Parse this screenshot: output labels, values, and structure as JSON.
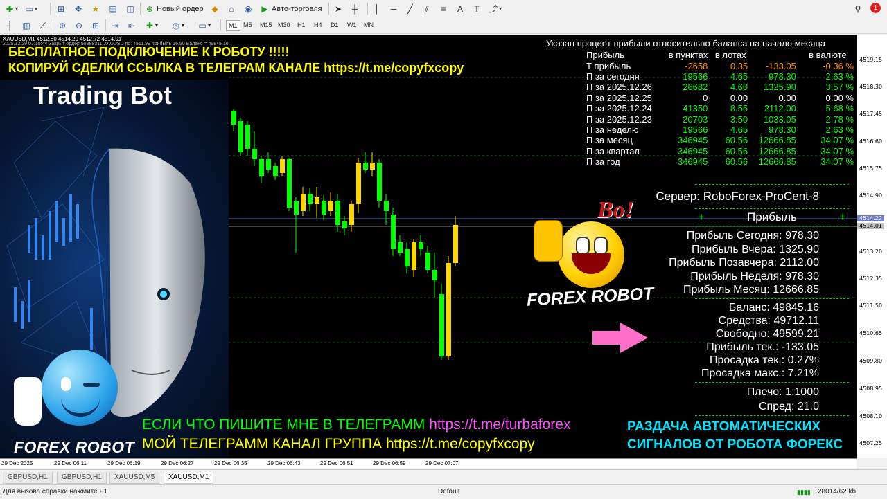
{
  "toolbar": {
    "new_order": "Новый ордер",
    "autotrading": "Авто-торговля",
    "timeframes": [
      "M1",
      "M5",
      "M15",
      "M30",
      "H1",
      "H4",
      "D1",
      "W1",
      "MN"
    ],
    "notification_count": "1"
  },
  "chart": {
    "symbol_line": "XAUUSD,M1  4512.80 4514.29 4512.72 4514.01",
    "info_line": "2025.12.29 07:10:44 Закрыт ордер 58888311 XAUUSD по: 4511.99 прибыль 16.50 Баланс = 49845.16",
    "price_axis": [
      "4519.15",
      "4518.30",
      "4517.45",
      "4516.60",
      "4515.75",
      "4514.90",
      "4514.22",
      "4514.01",
      "4513.20",
      "4512.35",
      "4511.50",
      "4510.65",
      "4509.80",
      "4508.95",
      "4508.10",
      "4507.25"
    ],
    "time_axis": [
      "29 Dec 2025",
      "29 Dec 06:11",
      "29 Dec 06:19",
      "29 Dec 06:27",
      "29 Dec 06:35",
      "29 Dec 06:43",
      "29 Dec 06:51",
      "29 Dec 06:59",
      "29 Dec 07:07"
    ],
    "colors": {
      "bull": "#ffd700",
      "bear": "#00ff00",
      "background": "#000000"
    }
  },
  "promo": {
    "line1": "БЕСПЛАТНОЕ ПОДКЛЮЧЕНИЕ К РОБОТУ !!!!!",
    "line2": "КОПИРУЙ СДЕЛКИ ССЫЛКА В ТЕЛЕГРАМ КАНАЛЕ https://t.me/copyfxcopy",
    "trading_bot": "Trading Bot",
    "forex_robot_left": "FOREX ROBOT",
    "forex_robot_mid": "FOREX ROBOT",
    "bo": "Bo!",
    "bottom1_a": "ЕСЛИ ЧТО ПИШИТЕ МНЕ В ТЕЛЕГРАММ ",
    "bottom1_b": "https://t.me/turbaforex",
    "bottom2": "МОЙ ТЕЛЕГРАММ КАНАЛ ГРУППА https://t.me/copyfxcopy",
    "right1": "РАЗДАЧА АВТОМАТИЧЕСКИХ",
    "right2": "СИГНАЛОВ ОТ РОБОТА ФОРЕКС"
  },
  "profit_table": {
    "caption": "Указан процент прибыли относительно баланса на начало месяца",
    "headers": [
      "Прибыль",
      "в пунктах",
      "в лотах",
      "",
      "в валюте"
    ],
    "rows": [
      {
        "label": "Т прибыль",
        "points": "-2658",
        "lots": "0.35",
        "money": "-133.05",
        "pct": "-0.36 %",
        "color": "#ff8c00"
      },
      {
        "label": "П за сегодня",
        "points": "19566",
        "lots": "4.65",
        "money": "978.30",
        "pct": "2.63 %",
        "color": "#00ff00"
      },
      {
        "label": "П за 2025.12.26",
        "points": "26682",
        "lots": "4.60",
        "money": "1325.90",
        "pct": "3.57 %",
        "color": "#00ff00"
      },
      {
        "label": "П за 2025.12.25",
        "points": "0",
        "lots": "0.00",
        "money": "0.00",
        "pct": "0.00 %",
        "color": "#ffffff"
      },
      {
        "label": "П за 2025.12.24",
        "points": "41350",
        "lots": "8.55",
        "money": "2112.00",
        "pct": "5.68 %",
        "color": "#00ff00"
      },
      {
        "label": "П за 2025.12.23",
        "points": "20703",
        "lots": "3.50",
        "money": "1033.05",
        "pct": "2.78 %",
        "color": "#00ff00"
      },
      {
        "label": "П за неделю",
        "points": "19566",
        "lots": "4.65",
        "money": "978.30",
        "pct": "2.63 %",
        "color": "#00ff00"
      },
      {
        "label": "П за месяц",
        "points": "346945",
        "lots": "60.56",
        "money": "12666.85",
        "pct": "34.07 %",
        "color": "#00ff00"
      },
      {
        "label": "П за квартал",
        "points": "346945",
        "lots": "60.56",
        "money": "12666.85",
        "pct": "34.07 %",
        "color": "#00ff00"
      },
      {
        "label": "П за год",
        "points": "346945",
        "lots": "60.56",
        "money": "12666.85",
        "pct": "34.07 %",
        "color": "#00ff00"
      }
    ]
  },
  "panel": {
    "server": "Сервер: RoboForex-ProCent-8",
    "profit_header": "Прибыль",
    "plus": "+",
    "profits": [
      "Прибыль Сегодня: 978.30",
      "Прибыль Вчера: 1325.90",
      "Прибыль Позавчера: 2112.00",
      "Прибыль Неделя: 978.30",
      "Прибыль Месяц: 12666.85"
    ],
    "account": [
      "Баланс: 49845.16",
      "Средства: 49712.11",
      "Свободно: 49599.21",
      "Прибыль тек.: -133.05",
      "Просадка тек.: 0.27%",
      "Просадка макс.: 7.21%"
    ],
    "leverage": "Плечо: 1:1000",
    "spread": "Спред: 21.0"
  },
  "tabs": [
    "GBPUSD,H1",
    "GBPUSD,H1",
    "XAUUSD,M5",
    "XAUUSD,M1"
  ],
  "active_tab": 3,
  "status": {
    "help": "Для вызова справки нажмите F1",
    "profile": "Default",
    "traffic": "28014/62 kb"
  }
}
